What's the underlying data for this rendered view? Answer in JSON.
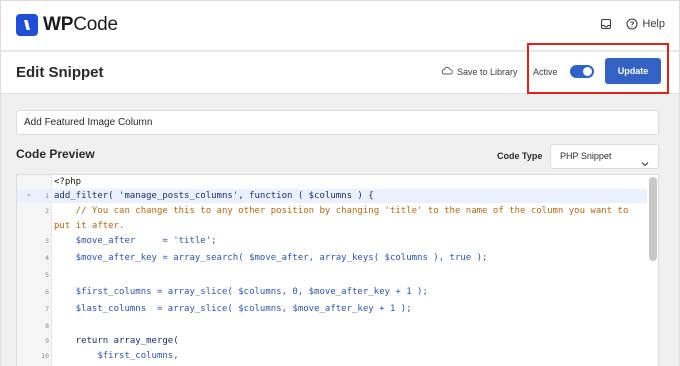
{
  "app": {
    "logo_text_prefix": "WP",
    "logo_text_suffix": "Code",
    "help_label": "Help"
  },
  "header": {
    "title": "Edit Snippet",
    "save_to_library": "Save to Library",
    "active_label": "Active",
    "active_on": true,
    "update_label": "Update"
  },
  "snippet": {
    "title_value": "Add Featured Image Column",
    "section_title": "Code Preview",
    "code_type_label": "Code Type",
    "code_type_value": "PHP Snippet"
  },
  "code": {
    "lines": [
      {
        "num": "",
        "text": "<?php"
      },
      {
        "num": "1",
        "text": "add_filter( 'manage_posts_columns', function ( $columns ) {"
      },
      {
        "num": "2",
        "text": "    // You can change this to any other position by changing 'title' to the name of the column you want to"
      },
      {
        "num": "",
        "text": "put it after."
      },
      {
        "num": "3",
        "text": "    $move_after     = 'title';"
      },
      {
        "num": "4",
        "text": "    $move_after_key = array_search( $move_after, array_keys( $columns ), true );"
      },
      {
        "num": "5",
        "text": ""
      },
      {
        "num": "6",
        "text": "    $first_columns = array_slice( $columns, 0, $move_after_key + 1 );"
      },
      {
        "num": "7",
        "text": "    $last_columns  = array_slice( $columns, $move_after_key + 1 );"
      },
      {
        "num": "8",
        "text": ""
      },
      {
        "num": "9",
        "text": "    return array_merge("
      },
      {
        "num": "10",
        "text": "        $first_columns,"
      }
    ]
  },
  "colors": {
    "accent": "#3361c4",
    "highlight_box": "#e2201c",
    "logo": "#1f4fd8"
  },
  "icons": {
    "logo": "wpcode-logo-icon",
    "inbox": "inbox-icon",
    "help": "help-circle-icon",
    "cloud": "cloud-icon",
    "chevron": "chevron-down-icon",
    "fold": "fold-arrow-icon"
  }
}
